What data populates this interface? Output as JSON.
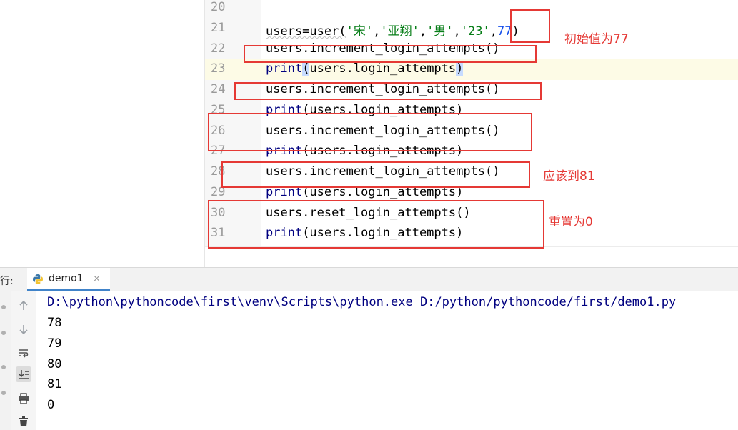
{
  "editor": {
    "lines": [
      {
        "num": "20",
        "code": ""
      },
      {
        "num": "21",
        "code_prefix": "users=user(",
        "s1": "'宋'",
        "c1": ",",
        "s2": "'亚翔'",
        "c2": ",",
        "s3": "'男'",
        "c3": ",",
        "s4": "'23'",
        "c4": ",",
        "n1": "77",
        "suffix": ")"
      },
      {
        "num": "22",
        "code": "users.increment_login_attempts()"
      },
      {
        "num": "23",
        "kw": "print",
        "open": "(",
        "arg": "users.login_attempts",
        "close": ")"
      },
      {
        "num": "24",
        "code": "users.increment_login_attempts()"
      },
      {
        "num": "25",
        "kw": "print",
        "rest": "(users.login_attempts)"
      },
      {
        "num": "26",
        "code": "users.increment_login_attempts()"
      },
      {
        "num": "27",
        "kw": "print",
        "rest": "(users.login_attempts)"
      },
      {
        "num": "28",
        "code": "users.increment_login_attempts()"
      },
      {
        "num": "29",
        "kw": "print",
        "rest": "(users.login_attempts)"
      },
      {
        "num": "30",
        "code": "users.reset_login_attempts()"
      },
      {
        "num": "31",
        "kw": "print",
        "rest": "(users.login_attempts)"
      }
    ]
  },
  "annotations": {
    "initial": "初始值为77",
    "should_reach": "应该到81",
    "reset": "重置为0",
    "color": "#e53935"
  },
  "run_panel": {
    "label": "行:",
    "tab_label": "demo1",
    "tab_close": "×",
    "tab_icon": "python-icon",
    "console": [
      "D:\\python\\pythoncode\\first\\venv\\Scripts\\python.exe D:/python/pythoncode/first/demo1.py",
      "78",
      "79",
      "80",
      "81",
      "0"
    ],
    "tools": [
      "arrow-up-icon",
      "arrow-down-icon",
      "soft-wrap-icon",
      "scroll-to-end-icon",
      "print-icon",
      "trash-icon"
    ]
  }
}
